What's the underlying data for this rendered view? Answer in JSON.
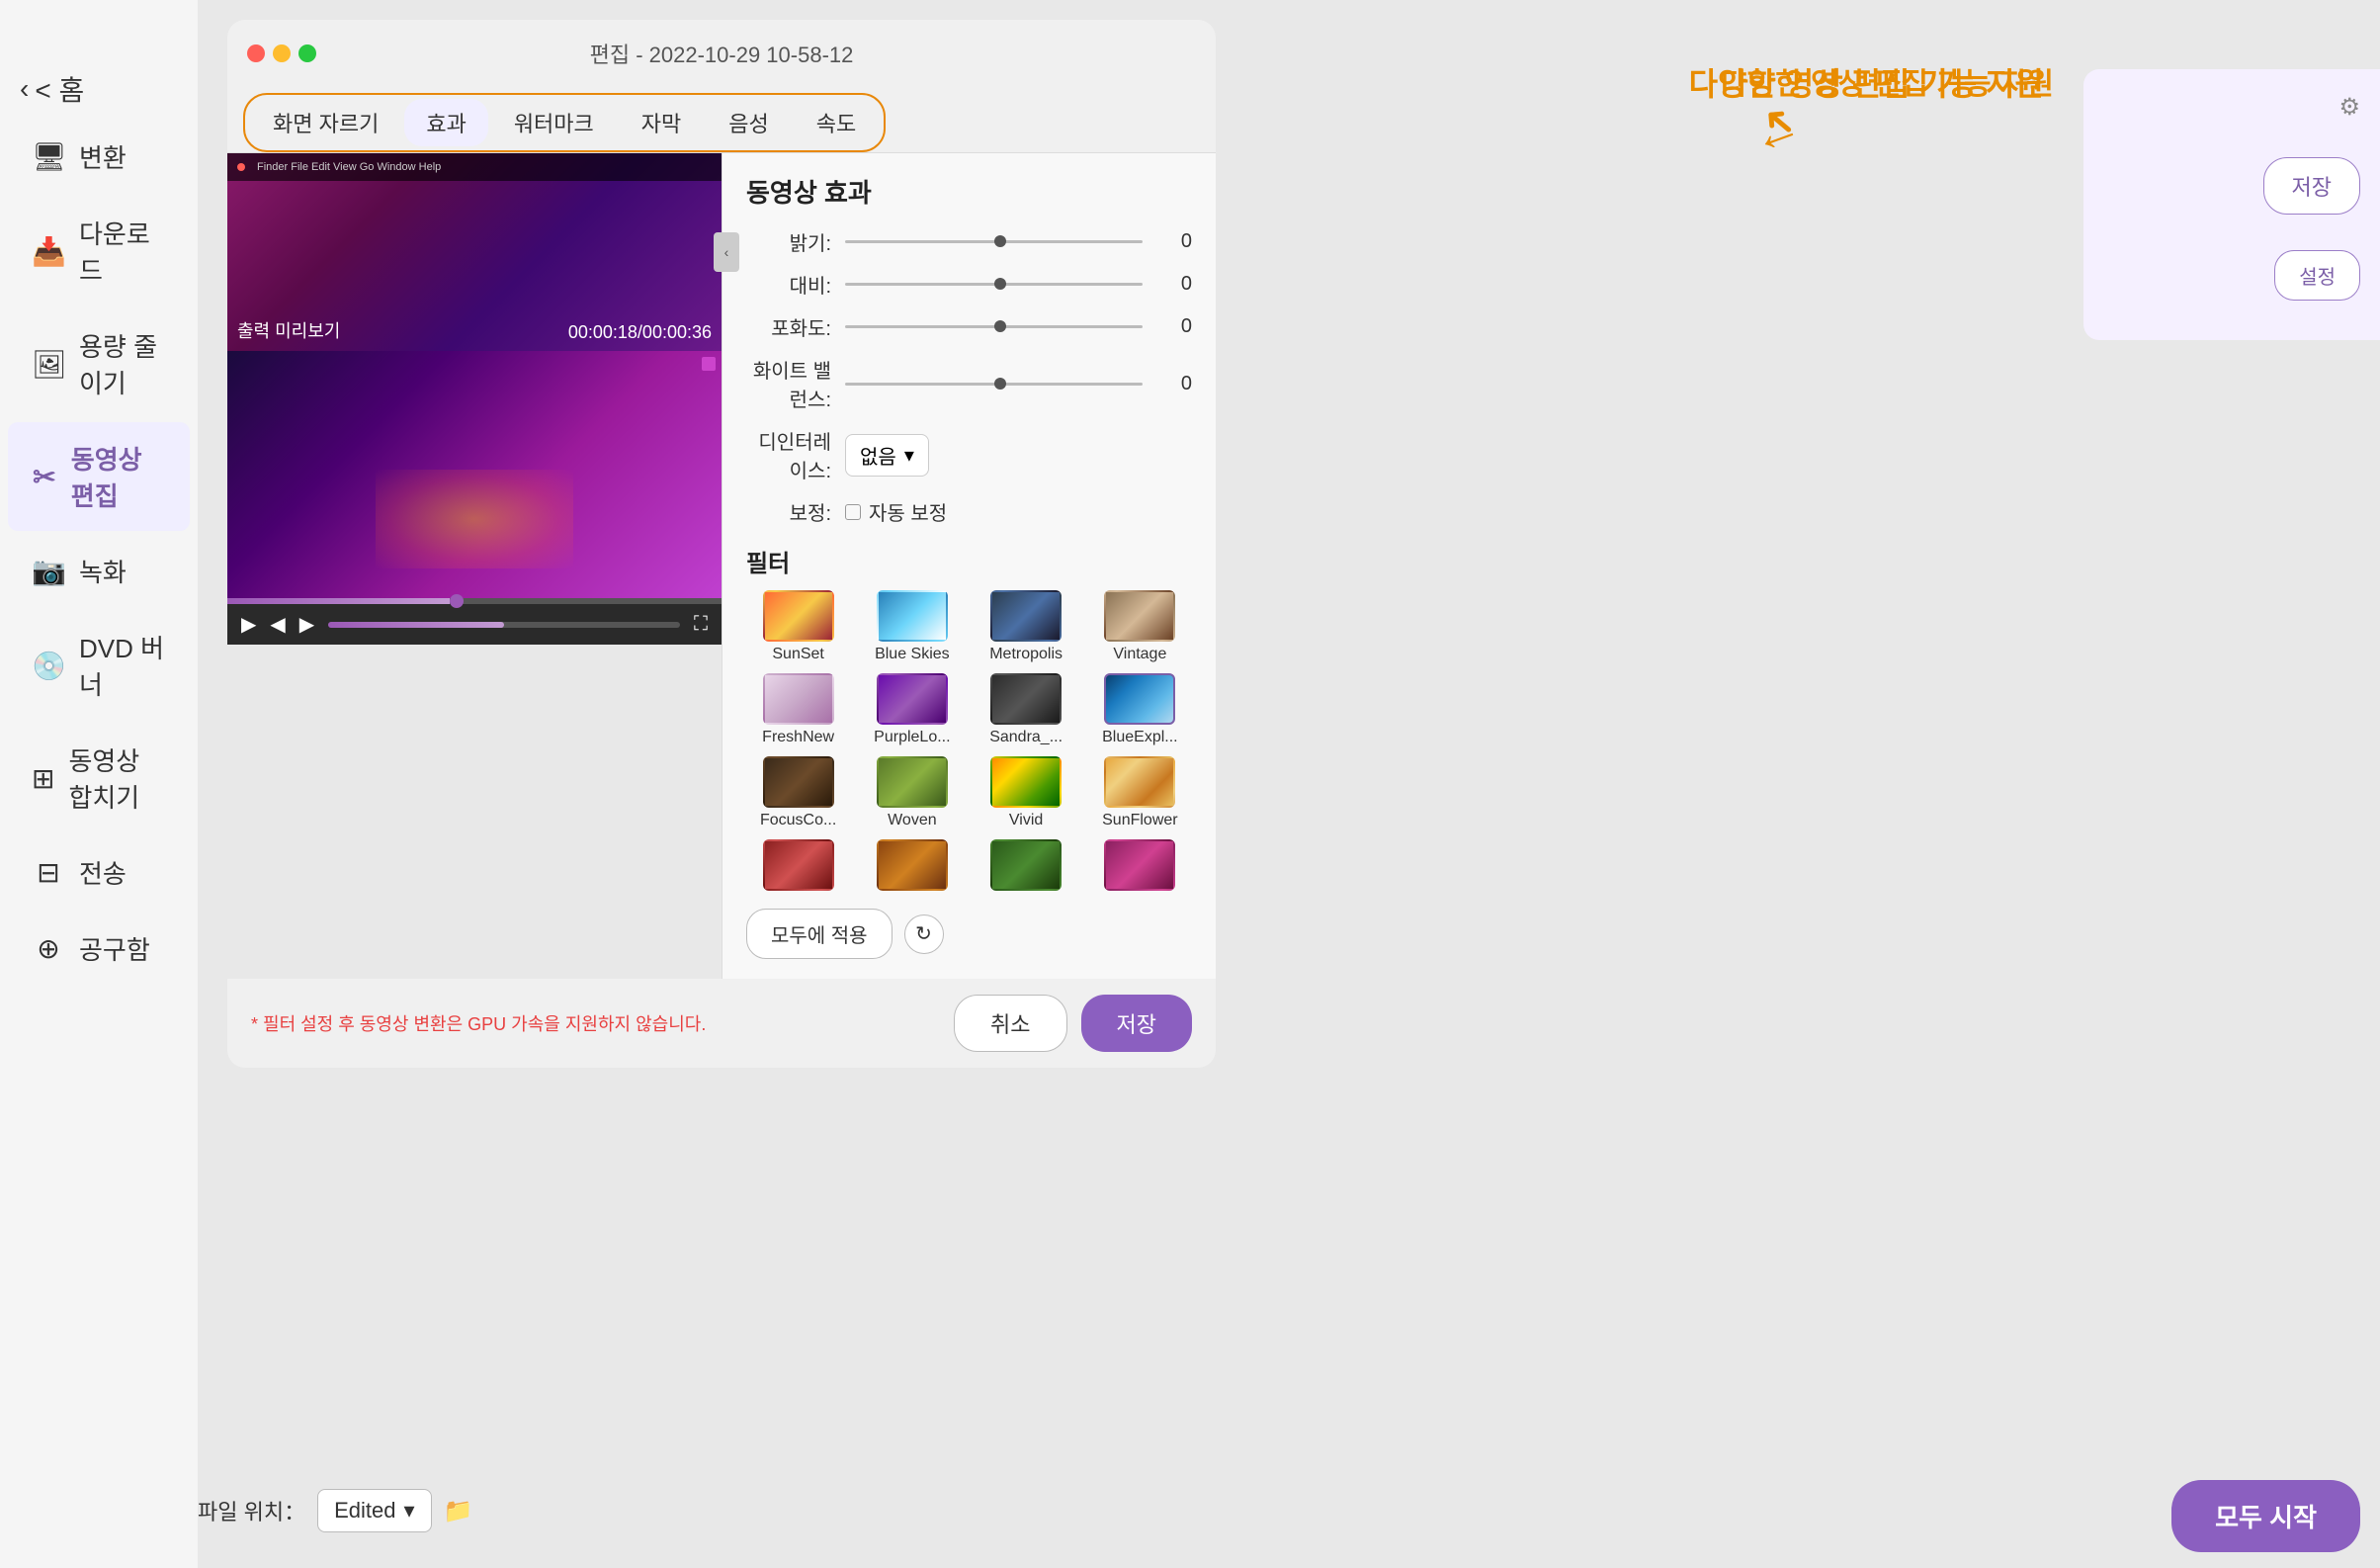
{
  "sidebar": {
    "back_label": "< 홈",
    "items": [
      {
        "id": "convert",
        "icon": "⬜",
        "label": "변환"
      },
      {
        "id": "download",
        "icon": "⬇",
        "label": "다운로드"
      },
      {
        "id": "compress",
        "icon": "⬜",
        "label": "용량 줄이기"
      },
      {
        "id": "video-edit",
        "icon": "✂",
        "label": "동영상 편집",
        "active": true
      },
      {
        "id": "record",
        "icon": "⬜",
        "label": "녹화"
      },
      {
        "id": "dvd",
        "icon": "⬜",
        "label": "DVD 버너"
      },
      {
        "id": "merge",
        "icon": "⬜",
        "label": "동영상 합치기"
      },
      {
        "id": "transfer",
        "icon": "⬜",
        "label": "전송"
      },
      {
        "id": "share",
        "icon": "⬜",
        "label": "공구함"
      }
    ]
  },
  "dialog": {
    "title": "편집 - 2022-10-29 10-58-12",
    "tabs": [
      {
        "id": "crop",
        "label": "화면 자르기"
      },
      {
        "id": "effects",
        "label": "효과",
        "active": true
      },
      {
        "id": "watermark",
        "label": "워터마크"
      },
      {
        "id": "subtitle",
        "label": "자막"
      },
      {
        "id": "audio",
        "label": "음성"
      },
      {
        "id": "speed",
        "label": "속도"
      }
    ],
    "video": {
      "preview_label": "출력 미리보기",
      "time_label": "00:00:18/00:00:36"
    },
    "effects": {
      "title": "동영상 효과",
      "brightness_label": "밝기:",
      "brightness_value": "0",
      "contrast_label": "대비:",
      "contrast_value": "0",
      "saturation_label": "포화도:",
      "saturation_value": "0",
      "white_balance_label": "화이트 밸런스:",
      "white_balance_value": "0",
      "deinterlace_label": "디인터레이스:",
      "deinterlace_value": "없음",
      "correction_label": "보정:",
      "auto_correct_label": "자동 보정"
    },
    "filters": {
      "title": "필터",
      "items": [
        {
          "id": "sunset",
          "name": "SunSet",
          "class": "ft-sunset",
          "selected": false
        },
        {
          "id": "blueskies",
          "name": "Blue Skies",
          "class": "ft-blueskies",
          "selected": false
        },
        {
          "id": "metropolis",
          "name": "Metropolis",
          "class": "ft-metro",
          "selected": false
        },
        {
          "id": "vintage",
          "name": "Vintage",
          "class": "ft-vintage",
          "selected": false
        },
        {
          "id": "freshnew",
          "name": "FreshNew",
          "class": "ft-freshnew",
          "selected": false
        },
        {
          "id": "purplelo",
          "name": "PurpleLo...",
          "class": "ft-purple",
          "selected": false
        },
        {
          "id": "sandra",
          "name": "Sandra_...",
          "class": "ft-sandra",
          "selected": false
        },
        {
          "id": "blueexpl",
          "name": "BlueExpl...",
          "class": "ft-blueexpl",
          "selected": true
        },
        {
          "id": "focusco",
          "name": "FocusCo...",
          "class": "ft-focusco",
          "selected": false
        },
        {
          "id": "woven",
          "name": "Woven",
          "class": "ft-woven",
          "selected": false
        },
        {
          "id": "vivid",
          "name": "Vivid",
          "class": "ft-vivid",
          "selected": false
        },
        {
          "id": "sunflower",
          "name": "SunFlower",
          "class": "ft-sunflower",
          "selected": false
        },
        {
          "id": "row4a",
          "name": "",
          "class": "ft-row4a",
          "selected": false
        },
        {
          "id": "row4b",
          "name": "",
          "class": "ft-row4b",
          "selected": false
        },
        {
          "id": "row4c",
          "name": "",
          "class": "ft-row4c",
          "selected": false
        },
        {
          "id": "row4d",
          "name": "",
          "class": "ft-row4d",
          "selected": false
        }
      ],
      "apply_all_btn": "모두에 적용"
    },
    "gpu_notice": "* 필터 설정 후 동영상 변환은 GPU 가속을 지원하지 않습니다.",
    "cancel_btn": "취소",
    "save_btn": "저장"
  },
  "promo": {
    "title": "다양한 영상 편집 기능 지원"
  },
  "filepath": {
    "label": "파일 위치：",
    "value": "Edited"
  },
  "right_panel": {
    "save_btn": "저장"
  },
  "start_all_btn": "모두 시작"
}
